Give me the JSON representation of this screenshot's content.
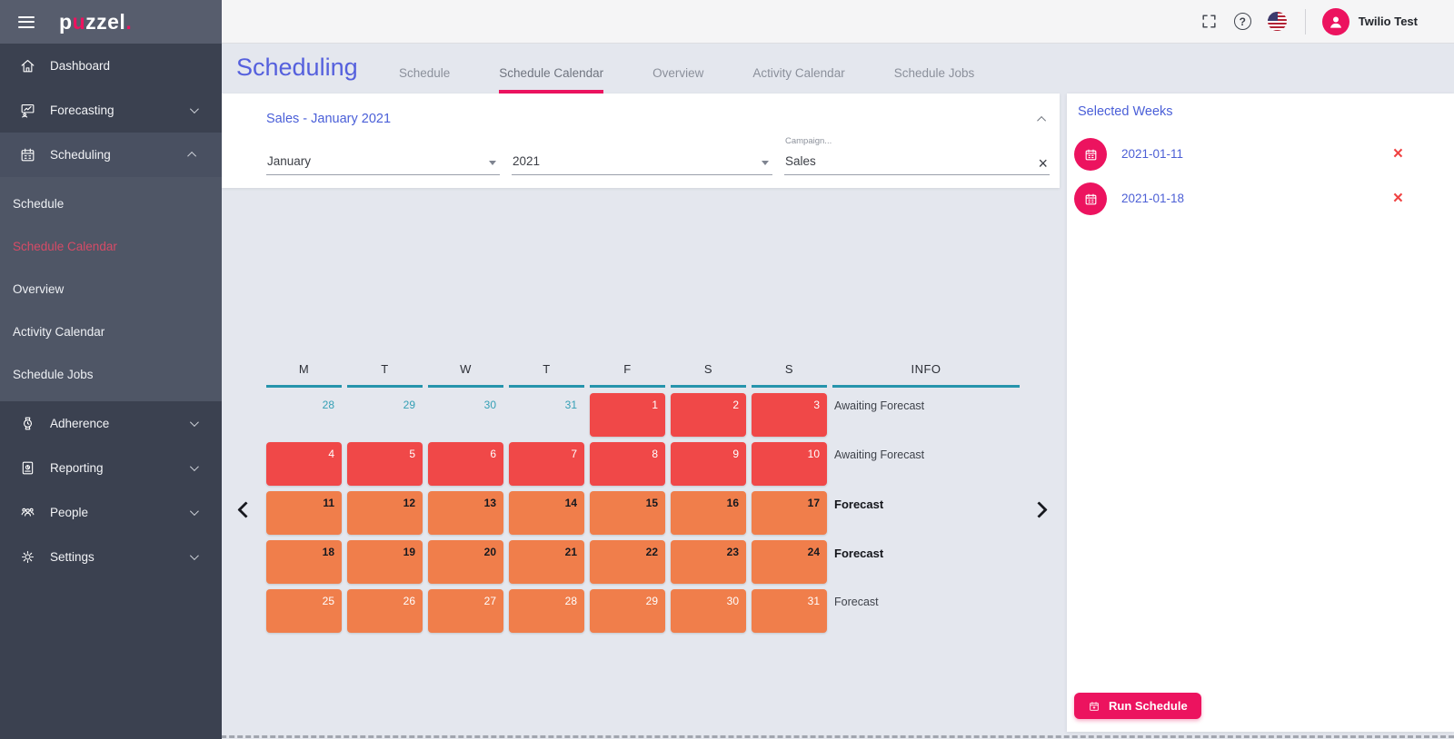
{
  "colors": {
    "accent_pink": "#ec135f",
    "title_blue": "#5560dd",
    "link_blue": "#4c5fd5",
    "cell_red": "#f04848",
    "cell_orange": "#f07e4b",
    "teal_underline": "#2694ac",
    "sidebar_bg": "#3b4150",
    "topbar_bg": "#575d6d",
    "remove_red": "#f04343"
  },
  "topbar": {
    "logo_p": "p",
    "logo_u": "u",
    "logo_zzel": "zzel",
    "logo_dot": ".",
    "help_glyph": "?",
    "user_name": "Twilio Test"
  },
  "sidebar": {
    "dashboard": "Dashboard",
    "forecasting": "Forecasting",
    "scheduling": "Scheduling",
    "submenu": [
      "Schedule",
      "Schedule Calendar",
      "Overview",
      "Activity Calendar",
      "Schedule Jobs"
    ],
    "active_subitem": "Schedule Calendar",
    "adherence": "Adherence",
    "reporting": "Reporting",
    "people": "People",
    "settings": "Settings"
  },
  "header": {
    "title": "Scheduling",
    "tabs": [
      "Schedule",
      "Schedule Calendar",
      "Overview",
      "Activity Calendar",
      "Schedule Jobs"
    ],
    "active_tab": "Schedule Calendar"
  },
  "filter": {
    "title": "Sales - January 2021",
    "month": "January",
    "year": "2021",
    "campaign_label": "Campaign...",
    "campaign_value": "Sales",
    "clear_glyph": "×"
  },
  "calendar": {
    "day_headers": [
      "M",
      "T",
      "W",
      "T",
      "F",
      "S",
      "S",
      "INFO"
    ],
    "rows": [
      {
        "info": "Awaiting Forecast",
        "bold": false,
        "cells": [
          {
            "d": "28",
            "t": "out"
          },
          {
            "d": "29",
            "t": "out"
          },
          {
            "d": "30",
            "t": "out"
          },
          {
            "d": "31",
            "t": "out"
          },
          {
            "d": "1",
            "t": "red"
          },
          {
            "d": "2",
            "t": "red"
          },
          {
            "d": "3",
            "t": "red"
          }
        ]
      },
      {
        "info": "Awaiting Forecast",
        "bold": false,
        "cells": [
          {
            "d": "4",
            "t": "red"
          },
          {
            "d": "5",
            "t": "red"
          },
          {
            "d": "6",
            "t": "red"
          },
          {
            "d": "7",
            "t": "red"
          },
          {
            "d": "8",
            "t": "red"
          },
          {
            "d": "9",
            "t": "red"
          },
          {
            "d": "10",
            "t": "red"
          }
        ]
      },
      {
        "info": "Forecast",
        "bold": true,
        "cells": [
          {
            "d": "11",
            "t": "orange-dark"
          },
          {
            "d": "12",
            "t": "orange-dark"
          },
          {
            "d": "13",
            "t": "orange-dark"
          },
          {
            "d": "14",
            "t": "orange-dark"
          },
          {
            "d": "15",
            "t": "orange-dark"
          },
          {
            "d": "16",
            "t": "orange-dark"
          },
          {
            "d": "17",
            "t": "orange-dark"
          }
        ]
      },
      {
        "info": "Forecast",
        "bold": true,
        "cells": [
          {
            "d": "18",
            "t": "orange-dark"
          },
          {
            "d": "19",
            "t": "orange-dark"
          },
          {
            "d": "20",
            "t": "orange-dark"
          },
          {
            "d": "21",
            "t": "orange-dark"
          },
          {
            "d": "22",
            "t": "orange-dark"
          },
          {
            "d": "23",
            "t": "orange-dark"
          },
          {
            "d": "24",
            "t": "orange-dark"
          }
        ]
      },
      {
        "info": "Forecast",
        "bold": false,
        "cells": [
          {
            "d": "25",
            "t": "orange"
          },
          {
            "d": "26",
            "t": "orange"
          },
          {
            "d": "27",
            "t": "orange"
          },
          {
            "d": "28",
            "t": "orange"
          },
          {
            "d": "29",
            "t": "orange"
          },
          {
            "d": "30",
            "t": "orange"
          },
          {
            "d": "31",
            "t": "orange"
          }
        ]
      }
    ]
  },
  "selected_weeks": {
    "title": "Selected Weeks",
    "weeks": [
      {
        "date": "2021-01-11"
      },
      {
        "date": "2021-01-18"
      }
    ],
    "remove_glyph": "×",
    "run_button": "Run Schedule"
  }
}
